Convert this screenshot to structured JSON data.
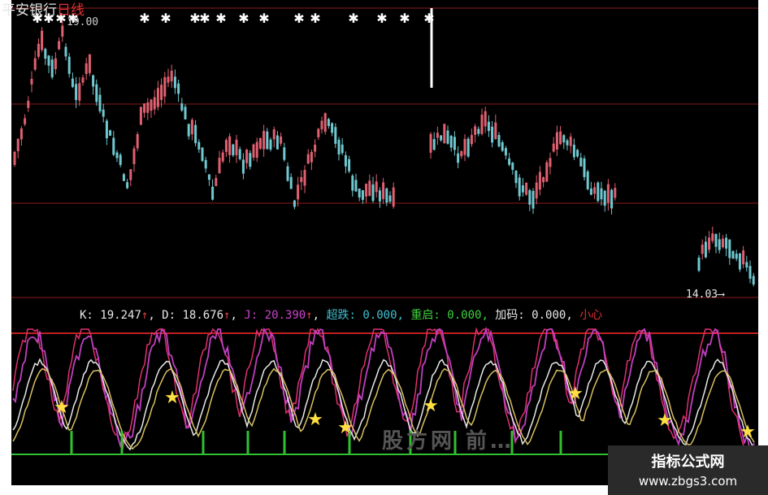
{
  "header": {
    "stock_name": "平安银行",
    "period": "日线",
    "high_label": "19.00",
    "low_label": "14.03"
  },
  "indicator": {
    "k_label": "K:",
    "k_value": "19.247",
    "d_label": "D:",
    "d_value": "18.676",
    "j_label": "J:",
    "j_value": "20.390",
    "arrow": "↑",
    "chaodie_label": "超跌:",
    "chaodie_value": "0.000",
    "chongqi_label": "重启:",
    "chongqi_value": "0.000",
    "jiama_label": "加码:",
    "jiama_value": "0.000",
    "xiaoxin_label": "小心"
  },
  "watermark": {
    "title": "指标公式网",
    "url": "www.zbgs3.com"
  },
  "overlay": {
    "text": "股方网 前…"
  },
  "colors": {
    "background": "#000000",
    "up_candle": "#e06070",
    "down_candle": "#70c8d0",
    "grid_red": "#8a1a1a",
    "k_line": "#e8e8e8",
    "d_line": "#d8c060",
    "j_line": "#c040c0",
    "pink_line": "#e03070",
    "star": "#ffe040",
    "green_line": "#30c030"
  }
}
